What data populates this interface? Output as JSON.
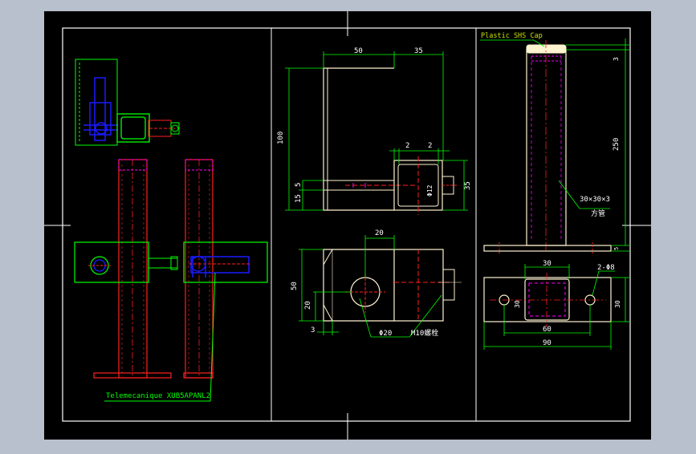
{
  "colors": {
    "background": "#b7c0cc",
    "sheet": "#000000",
    "border": "#ffffff",
    "green": "#00ff00",
    "red": "#ff2020",
    "blue": "#1a1aff",
    "magenta": "#ff00ff",
    "yellow_green": "#c8e000",
    "cream": "#fff4d0"
  },
  "labels": {
    "telemecanique": "Telemecanique XUB5APANL2",
    "plastic_cap": "Plastic SHS Cap",
    "tube_spec": "30×30×3",
    "tube_name": "方管",
    "bolt_label": "M10螺栓",
    "holes": "2-Φ8",
    "hole_dia": "Φ20",
    "pin_dia": "Φ12"
  },
  "dims": {
    "top_a": "50",
    "top_b": "35",
    "height": "100",
    "gap_a": "2",
    "gap_b": "2",
    "left_a": "5",
    "left_b": "15",
    "right_a": "35",
    "plan_top": "20",
    "plan_height": "50",
    "plan_a": "20",
    "plan_b": "3",
    "cap_t": "3",
    "tube_len": "250",
    "base_w": "30",
    "base_t": "5",
    "plate_w": "60",
    "plate_total": "90",
    "plate_h": "30",
    "plate_r": "30"
  }
}
